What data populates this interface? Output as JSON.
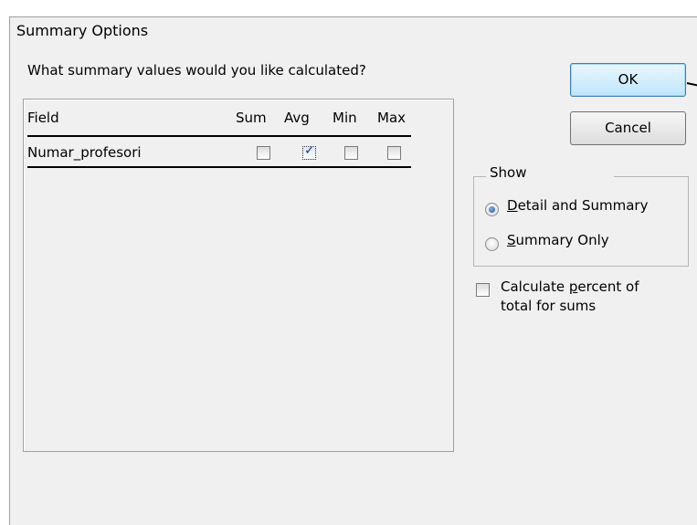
{
  "window": {
    "title": "Summary Options"
  },
  "prompt": "What summary values would you like calculated?",
  "table": {
    "headers": {
      "field": "Field",
      "sum": "Sum",
      "avg": "Avg",
      "min": "Min",
      "max": "Max"
    },
    "rows": [
      {
        "field": "Numar_profesori",
        "sum": false,
        "avg": true,
        "min": false,
        "max": false
      }
    ]
  },
  "buttons": {
    "ok": "OK",
    "cancel": "Cancel"
  },
  "show_group": {
    "legend": "Show",
    "options": [
      {
        "mnemonic": "D",
        "rest": "etail and Summary",
        "selected": true
      },
      {
        "mnemonic": "S",
        "rest": "ummary Only",
        "selected": false
      }
    ]
  },
  "percent_checkbox": {
    "line1_pre": "Calculate ",
    "line1_mnemonic": "p",
    "line1_post": "ercent of",
    "line2": "total for sums",
    "checked": false
  },
  "icons": {
    "checkmark": "checkmark-icon"
  }
}
